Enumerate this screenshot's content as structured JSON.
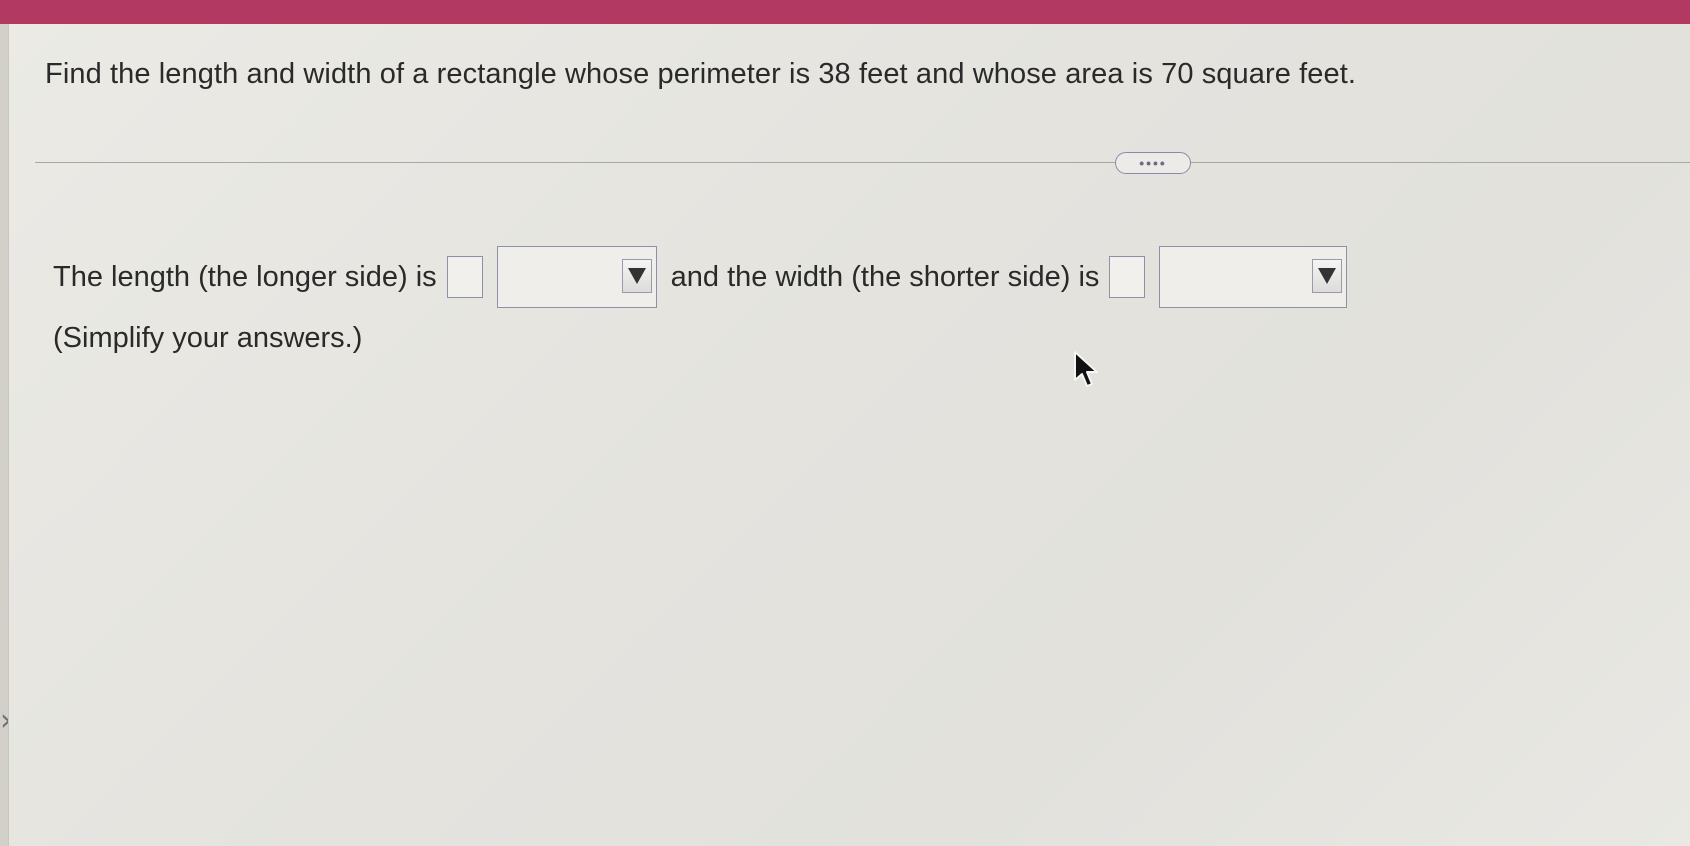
{
  "question": {
    "text": "Find the length and width of a rectangle whose perimeter is 38 feet and whose area is 70 square feet."
  },
  "more_button": {
    "label": "••••"
  },
  "answer": {
    "length_prefix": "The length (the longer side) is",
    "connector": "and the width (the shorter side) is",
    "length_value": "",
    "length_unit_selected": "",
    "width_value": "",
    "width_unit_selected": "",
    "hint": "(Simplify your answers.)"
  },
  "icons": {
    "dropdown": "chevron-down-icon",
    "cursor": "mouse-cursor-icon",
    "side_nav": "chevron-right-icon"
  },
  "colors": {
    "header": "#b23a62",
    "background": "#e6e5e0",
    "text": "#2a2a2a",
    "field_border": "#8f8fa8"
  }
}
